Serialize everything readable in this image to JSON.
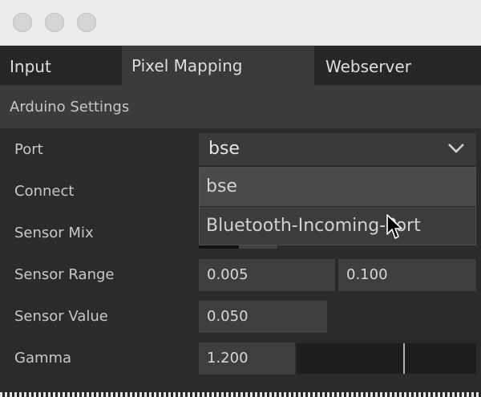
{
  "tabs": [
    {
      "label": "Input",
      "active": false
    },
    {
      "label": "Pixel Mapping",
      "active": true
    },
    {
      "label": "Webserver",
      "active": false
    }
  ],
  "section": {
    "title": "Arduino Settings"
  },
  "rows": {
    "port": {
      "label": "Port",
      "value": "bse"
    },
    "connect": {
      "label": "Connect"
    },
    "sensor_mix": {
      "label": "Sensor Mix"
    },
    "sensor_range": {
      "label": "Sensor Range",
      "min": "0.005",
      "max": "0.100"
    },
    "sensor_value": {
      "label": "Sensor Value",
      "value": "0.050"
    },
    "gamma": {
      "label": "Gamma",
      "value": "1.200",
      "slider_fraction": 0.6
    }
  },
  "dropdown": {
    "options": [
      "bse",
      "Bluetooth-Incoming-Port"
    ],
    "highlighted_index": 0
  },
  "icons": {
    "chevron": "chevron-down-icon",
    "cursor": "pointer-cursor-icon"
  },
  "colors": {
    "panel": "#2b2b2b",
    "active_tab": "#3a3a3a",
    "field": "#3e3e3e"
  }
}
